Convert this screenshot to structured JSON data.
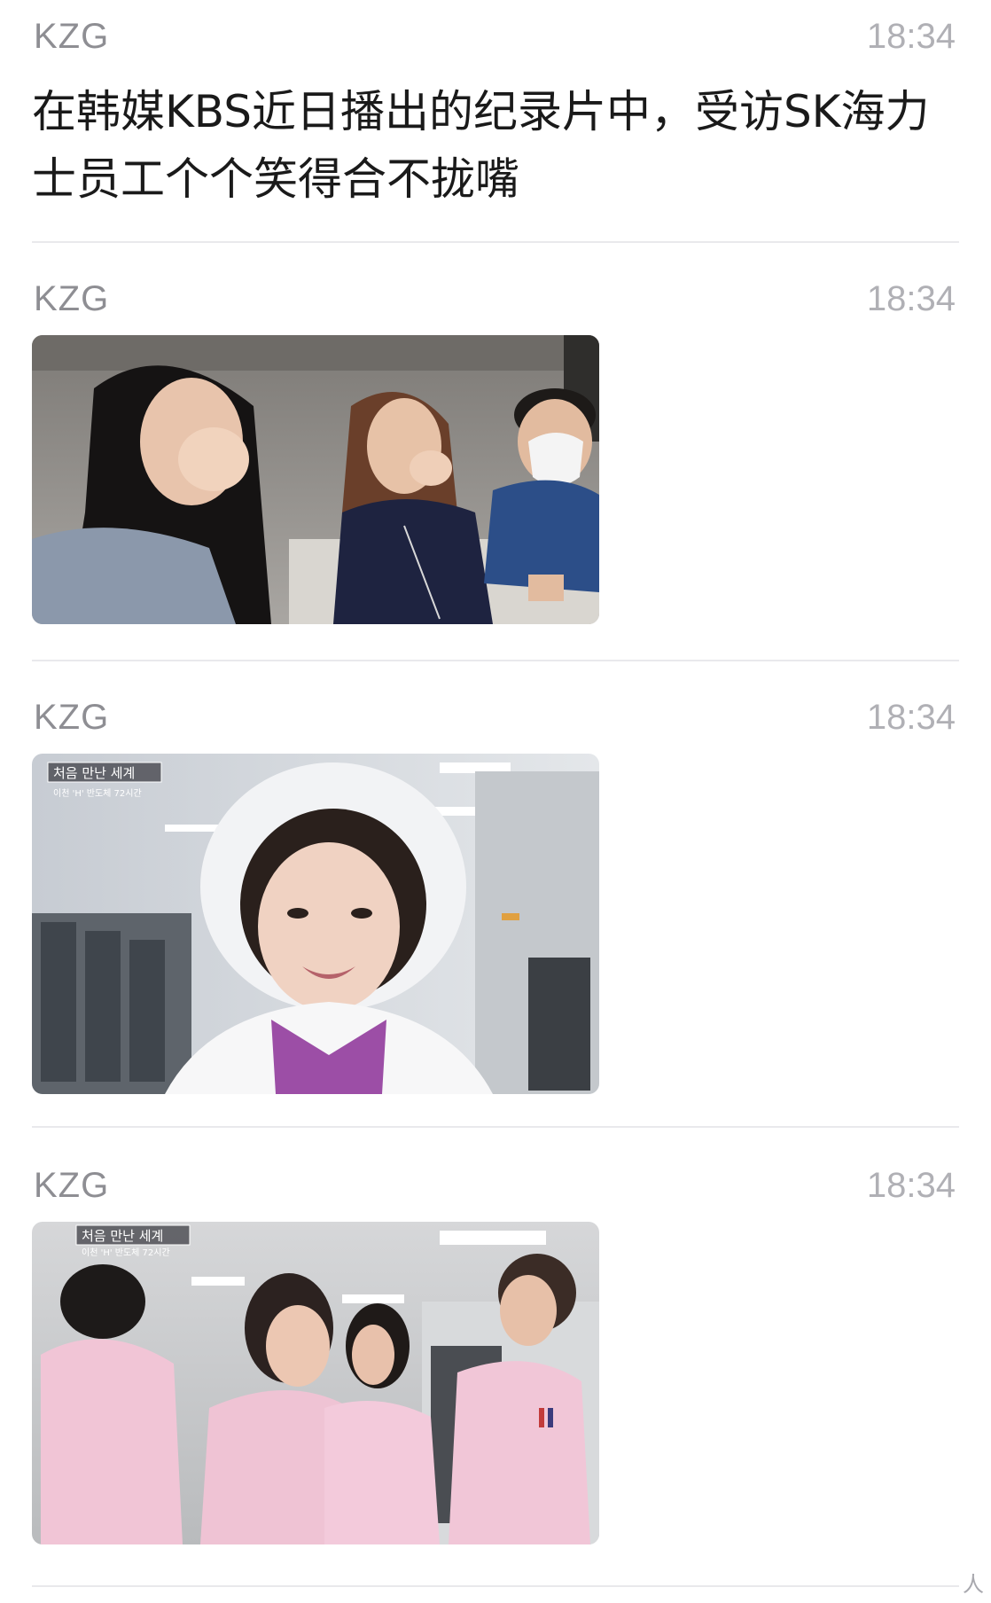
{
  "messages": [
    {
      "sender": "KZG",
      "time": "18:34",
      "text": "在韩媒KBS近日播出的纪录片中，受访SK海力士员工个个笑得合不拢嘴"
    },
    {
      "sender": "KZG",
      "time": "18:34"
    },
    {
      "sender": "KZG",
      "time": "18:34"
    },
    {
      "sender": "KZG",
      "time": "18:34"
    }
  ],
  "overlays": {
    "program_title": "처음 만난 세계",
    "program_subtitle": "이천 'H' 반도체 72시간"
  },
  "watermark": "人"
}
